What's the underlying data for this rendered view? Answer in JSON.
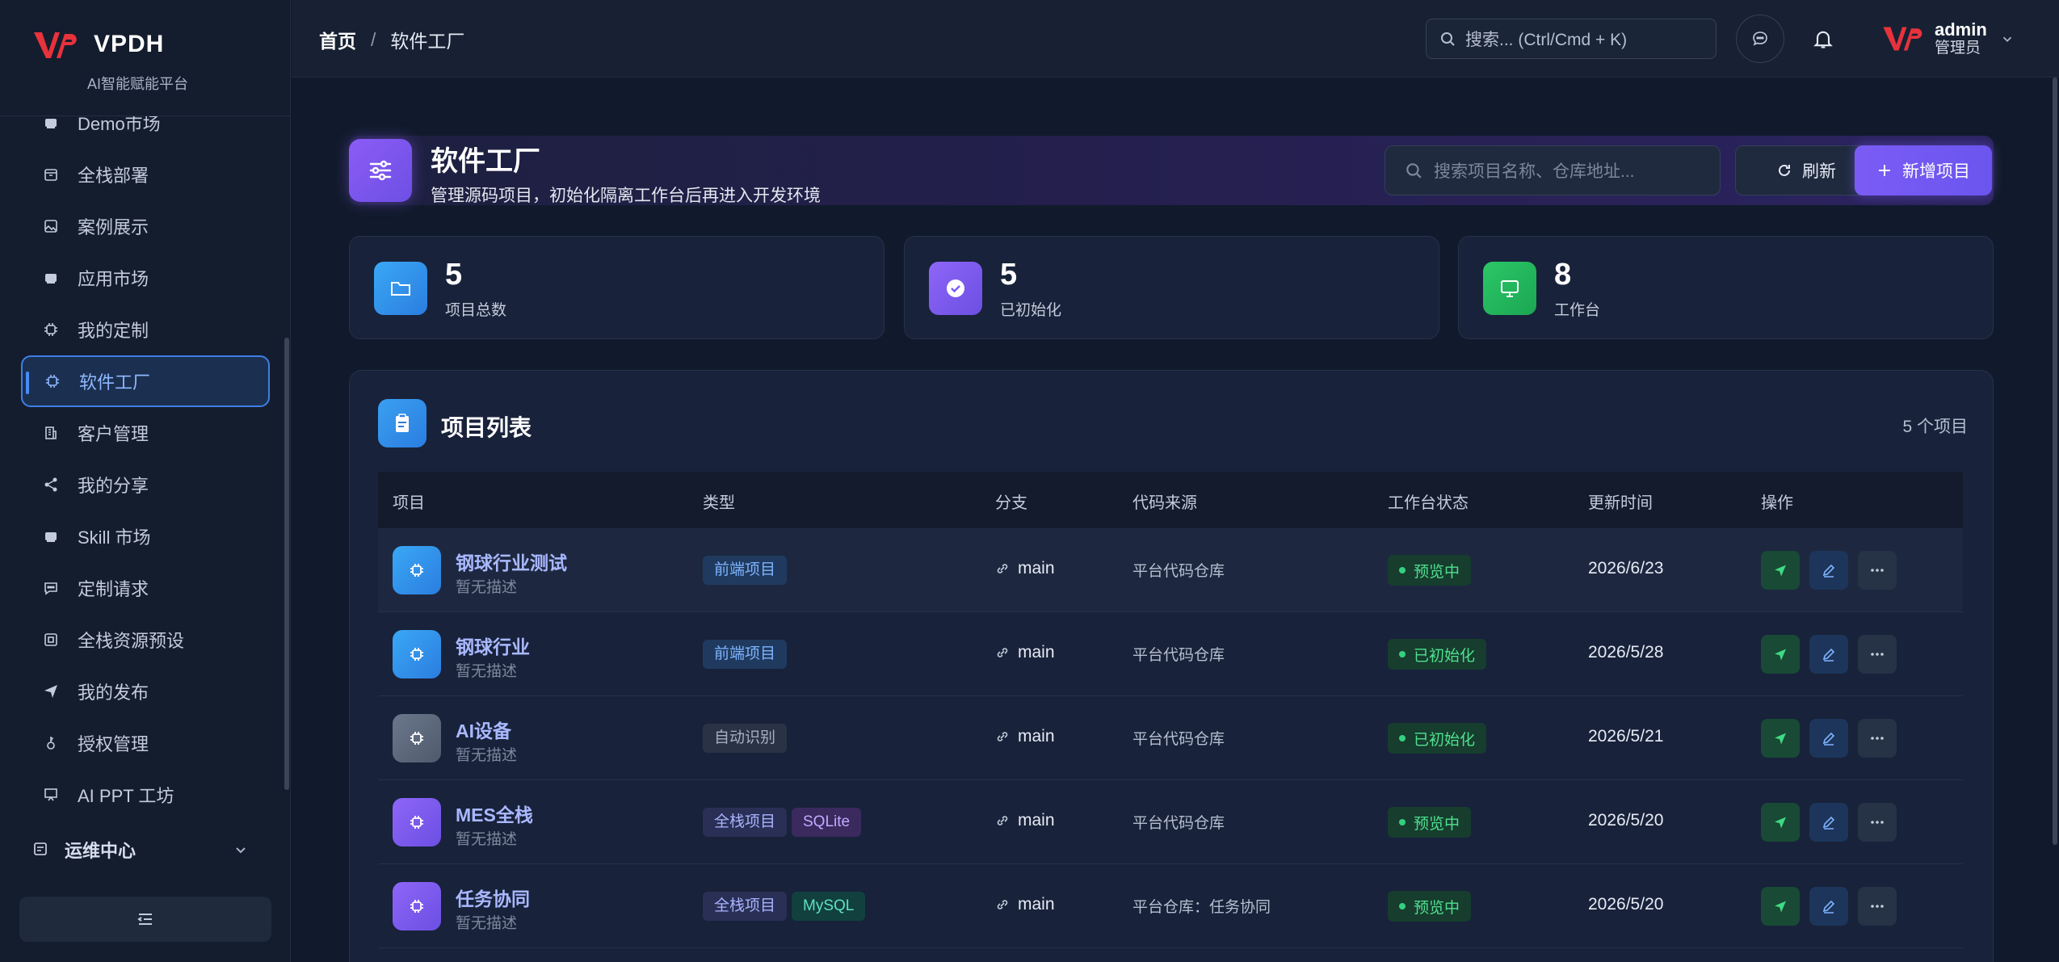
{
  "brand": {
    "name": "VPDH",
    "subtitle": "AI智能赋能平台"
  },
  "sidebar": {
    "items": [
      {
        "label": "Demo市场",
        "icon": "store-icon"
      },
      {
        "label": "全栈部署",
        "icon": "package-icon"
      },
      {
        "label": "案例展示",
        "icon": "image-icon"
      },
      {
        "label": "应用市场",
        "icon": "store-icon"
      },
      {
        "label": "我的定制",
        "icon": "chip-icon"
      },
      {
        "label": "软件工厂",
        "icon": "chip-icon",
        "active": true
      },
      {
        "label": "客户管理",
        "icon": "building-icon"
      },
      {
        "label": "我的分享",
        "icon": "share-icon"
      },
      {
        "label": "Skill 市场",
        "icon": "store-icon"
      },
      {
        "label": "定制请求",
        "icon": "message-icon"
      },
      {
        "label": "全栈资源预设",
        "icon": "preset-icon"
      },
      {
        "label": "我的发布",
        "icon": "send-icon"
      },
      {
        "label": "授权管理",
        "icon": "key-icon"
      },
      {
        "label": "AI PPT 工坊",
        "icon": "presentation-icon"
      }
    ],
    "group": {
      "label": "运维中心",
      "icon": "ops-icon"
    }
  },
  "topbar": {
    "breadcrumb": {
      "home": "首页",
      "separator": "/",
      "current": "软件工厂"
    },
    "search_placeholder": "搜索... (Ctrl/Cmd + K)",
    "user": {
      "name": "admin",
      "role": "管理员"
    }
  },
  "header": {
    "title": "软件工厂",
    "subtitle": "管理源码项目，初始化隔离工作台后再进入开发环境",
    "search_placeholder": "搜索项目名称、仓库地址...",
    "refresh_label": "刷新",
    "add_label": "新增项目"
  },
  "stats": [
    {
      "value": "5",
      "label": "项目总数",
      "icon": "folder-icon",
      "color": "#2f8ff0"
    },
    {
      "value": "5",
      "label": "已初始化",
      "icon": "check-circle-icon",
      "color": "#7c5cf5"
    },
    {
      "value": "8",
      "label": "工作台",
      "icon": "monitor-icon",
      "color": "#20b15a"
    }
  ],
  "list": {
    "title": "项目列表",
    "count_label": "5 个项目",
    "columns": [
      "项目",
      "类型",
      "分支",
      "代码来源",
      "工作台状态",
      "更新时间",
      "操作"
    ],
    "rows": [
      {
        "name": "钢球行业测试",
        "desc": "暂无描述",
        "tags": [
          {
            "text": "前端项目",
            "kind": "front"
          }
        ],
        "branch": "main",
        "source": "平台代码仓库",
        "status": "预览中",
        "date": "2026/6/23",
        "icon_color": "#2b8fe8"
      },
      {
        "name": "钢球行业",
        "desc": "暂无描述",
        "tags": [
          {
            "text": "前端项目",
            "kind": "front"
          }
        ],
        "branch": "main",
        "source": "平台代码仓库",
        "status": "已初始化",
        "date": "2026/5/28",
        "icon_color": "#2b8fe8"
      },
      {
        "name": "AI设备",
        "desc": "暂无描述",
        "tags": [
          {
            "text": "自动识别",
            "kind": "auto"
          }
        ],
        "branch": "main",
        "source": "平台代码仓库",
        "status": "已初始化",
        "date": "2026/5/21",
        "icon_color": "#5b6679"
      },
      {
        "name": "MES全栈",
        "desc": "暂无描述",
        "tags": [
          {
            "text": "全栈项目",
            "kind": "full"
          },
          {
            "text": "SQLite",
            "kind": "sqlite"
          }
        ],
        "branch": "main",
        "source": "平台代码仓库",
        "status": "预览中",
        "date": "2026/5/20",
        "icon_color": "#7655f0"
      },
      {
        "name": "任务协同",
        "desc": "暂无描述",
        "tags": [
          {
            "text": "全栈项目",
            "kind": "full"
          },
          {
            "text": "MySQL",
            "kind": "mysql"
          }
        ],
        "branch": "main",
        "source": "平台仓库：任务协同",
        "status": "预览中",
        "date": "2026/5/20",
        "icon_color": "#7655f0"
      }
    ]
  },
  "colors": {
    "accent": "#7b5cf5",
    "active_blue": "#3e7fe6",
    "success": "#35d07f"
  }
}
